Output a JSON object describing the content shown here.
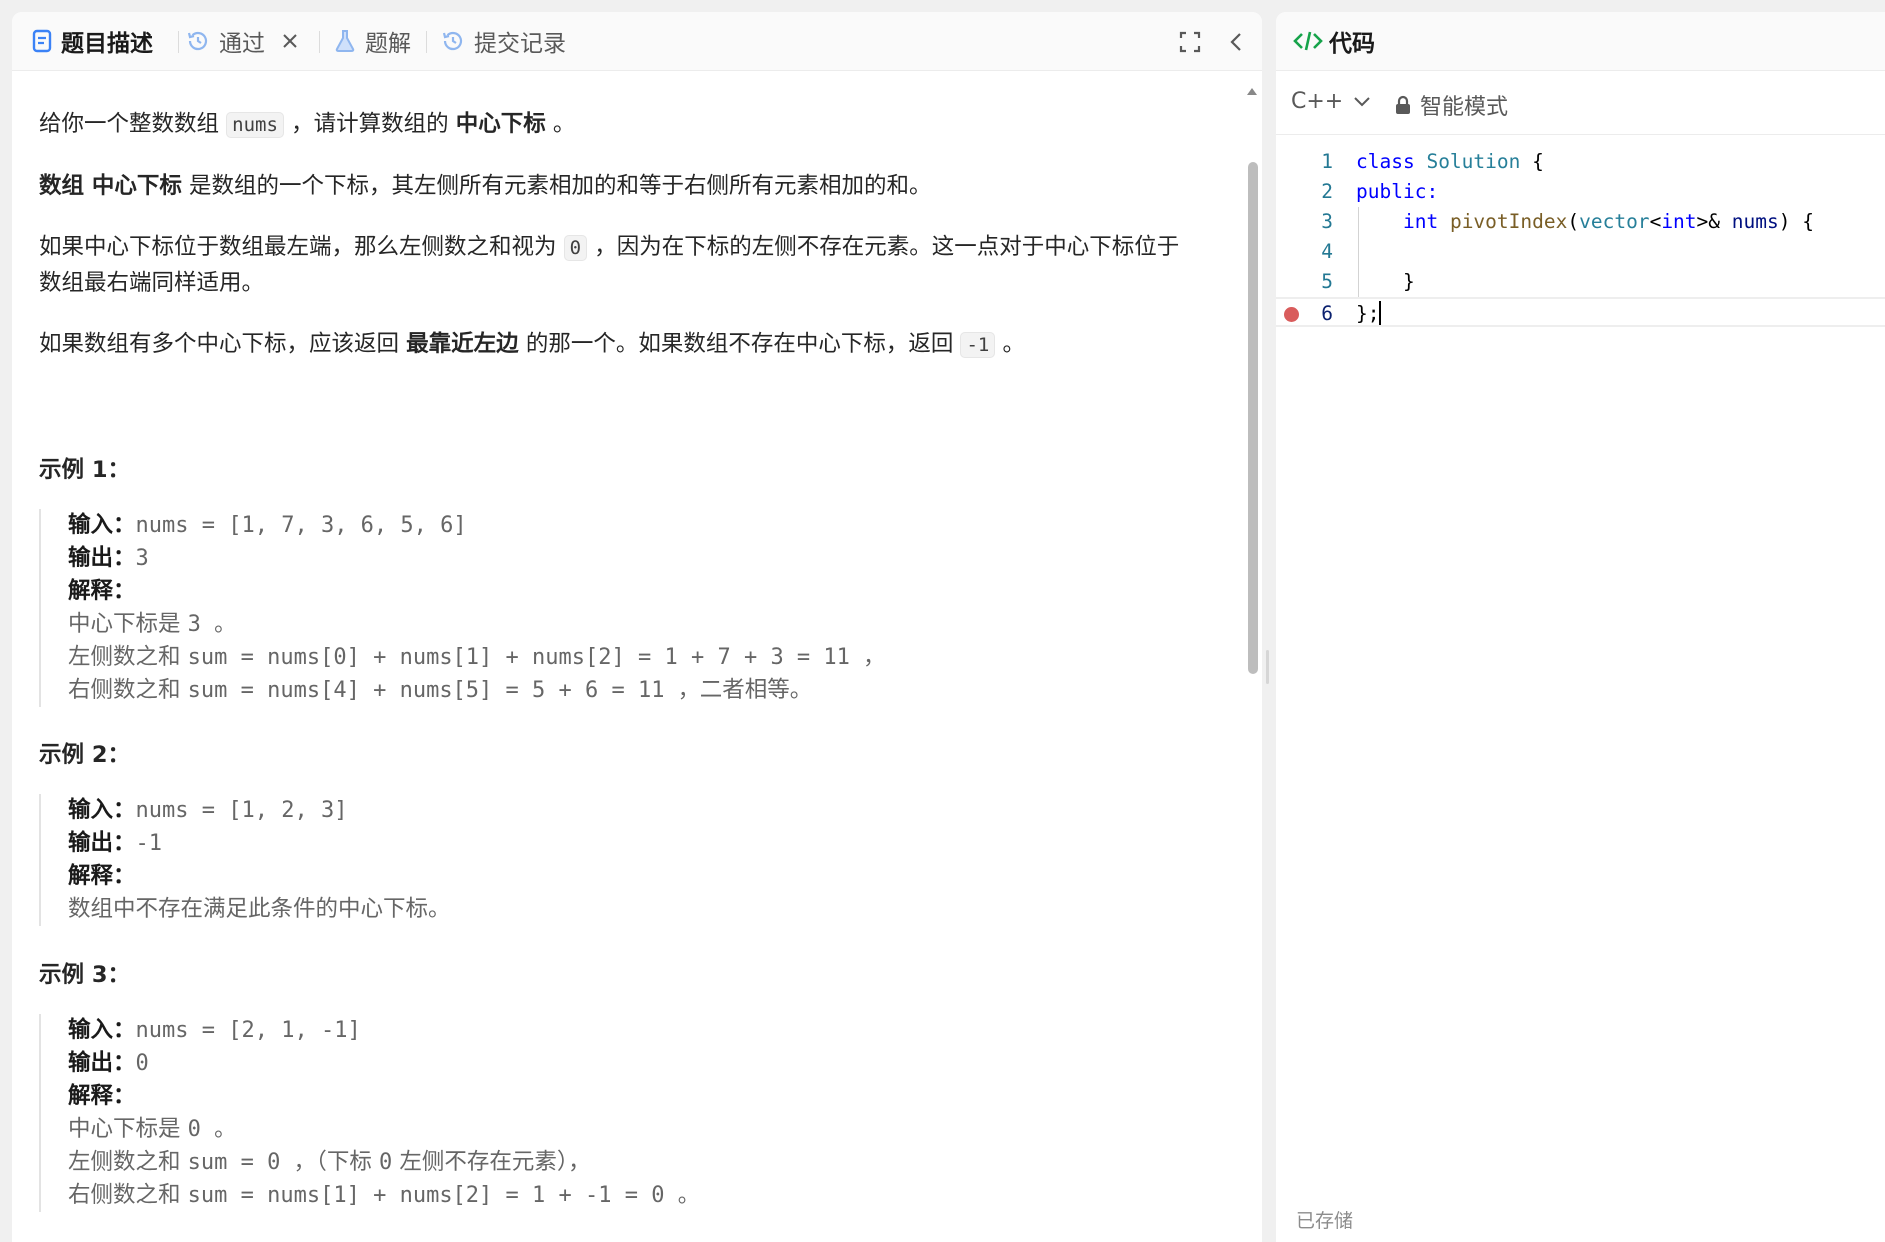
{
  "tabs": [
    {
      "label": "题目描述",
      "icon": "document-icon"
    },
    {
      "label": "通过",
      "icon": "history-icon"
    },
    {
      "label": "题解",
      "icon": "flask-icon"
    },
    {
      "label": "提交记录",
      "icon": "history-icon"
    }
  ],
  "description": {
    "p1": {
      "a": "给你一个整数数组 ",
      "code": "nums",
      "b": " ，请计算数组的 ",
      "bold": "中心下标",
      "c": " 。"
    },
    "p2": {
      "bold": "数组 中心下标",
      "a": " 是数组的一个下标，其左侧所有元素相加的和等于右侧所有元素相加的和。"
    },
    "p3": {
      "a": "如果中心下标位于数组最左端，那么左侧数之和视为 ",
      "code": "0",
      "b": " ，因为在下标的左侧不存在元素。这一点对于中心下标位于",
      "c": "数组最右端同样适用。"
    },
    "p4": {
      "a": "如果数组有多个中心下标，应该返回 ",
      "bold": "最靠近左边",
      "b": " 的那一个。如果数组不存在中心下标，返回 ",
      "code": "-1",
      "c": " 。"
    }
  },
  "labels": {
    "input": "输入：",
    "output": "输出：",
    "explain": "解释："
  },
  "examples": [
    {
      "title": "示例 1：",
      "input": "nums = [1, 7, 3, 6, 5, 6]",
      "output": "3",
      "lines": [
        {
          "t": "中心下标是 ",
          "m": "3 。"
        },
        {
          "t": "左侧数之和 ",
          "m": "sum = nums[0] + nums[1] + nums[2] = 1 + 7 + 3 = 11 ，"
        },
        {
          "t": "右侧数之和 ",
          "m": "sum = nums[4] + nums[5] = 5 + 6 = 11 ，",
          "e": "二者相等。"
        }
      ]
    },
    {
      "title": "示例 2：",
      "input": "nums = [1, 2, 3]",
      "output": "-1",
      "lines": [
        {
          "t": "数组中不存在满足此条件的中心下标。"
        }
      ]
    },
    {
      "title": "示例 3：",
      "input": "nums = [2, 1, -1]",
      "output": "0",
      "lines": [
        {
          "t": "中心下标是 ",
          "m": "0 。"
        },
        {
          "t": "左侧数之和 ",
          "m": "sum = 0 ，",
          "e": "（下标 ",
          "m2": "0",
          "e2": " 左侧不存在元素），"
        },
        {
          "t": "右侧数之和 ",
          "m": "sum = nums[1] + nums[2] = 1 + -1 = 0 。"
        }
      ]
    }
  ],
  "code_panel": {
    "title": "代码",
    "language": "C++",
    "mode": "智能模式",
    "saved_status": "已存储",
    "line_numbers": [
      "1",
      "2",
      "3",
      "4",
      "5",
      "6"
    ],
    "code": {
      "l1_kw": "class",
      "l1_ty": "Solution",
      "l1_rest": " {",
      "l2_kw": "public:",
      "l3_kw": "int",
      "l3_fn": "pivotIndex",
      "l3_ty": "vector",
      "l3_kw2": "int",
      "l3_pm": "nums",
      "l3_rest": ") {",
      "l5": "    }",
      "l6": "};"
    }
  },
  "colors": {
    "accent": "#3b82f6",
    "breakpoint": "#d95c5c",
    "code_icon": "#16a34a"
  }
}
